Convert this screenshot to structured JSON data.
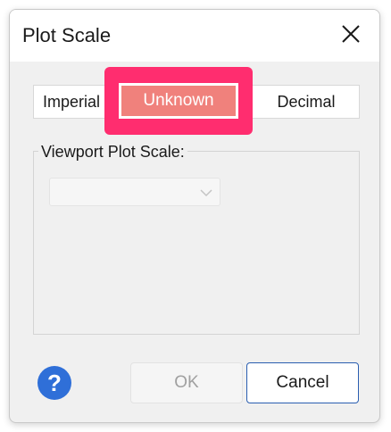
{
  "dialog": {
    "title": "Plot Scale",
    "close_icon": "close-icon"
  },
  "units": {
    "options": [
      "Imperial",
      "Unknown",
      "Decimal"
    ],
    "selected": "Unknown"
  },
  "viewport": {
    "label": "Viewport Plot Scale:",
    "dropdown_value": "",
    "dropdown_icon": "chevron-down-icon",
    "disabled": true
  },
  "footer": {
    "help_icon": "help-icon",
    "ok_label": "OK",
    "ok_disabled": true,
    "cancel_label": "Cancel"
  },
  "colors": {
    "highlight": "#ff2d6f",
    "selected_fill": "#f0817c",
    "help_blue": "#2f6fd8",
    "cancel_border": "#2a5eb0"
  }
}
